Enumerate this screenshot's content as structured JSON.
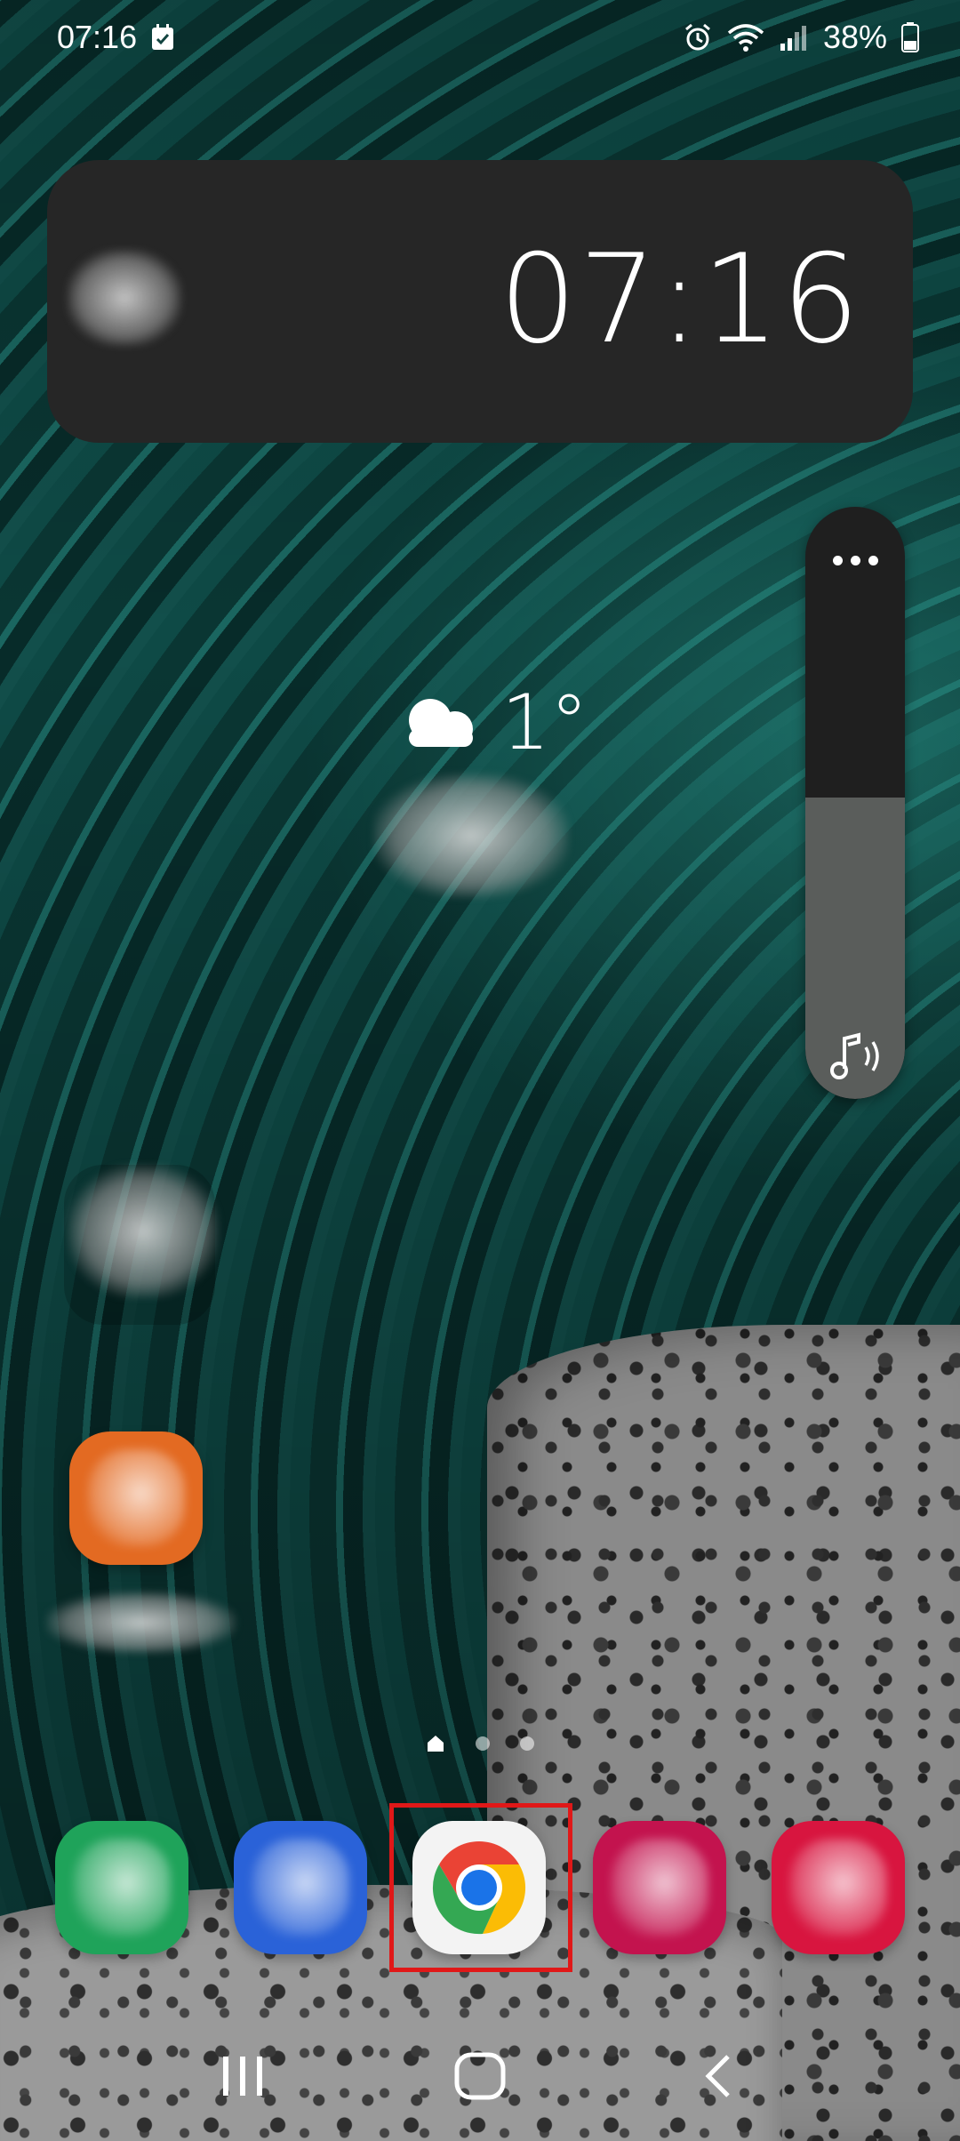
{
  "status_bar": {
    "time": "07:16",
    "battery_percent": "38%",
    "icons": [
      "calendar-check-icon",
      "alarm-icon",
      "wifi-icon",
      "signal-icon",
      "battery-icon"
    ]
  },
  "clock_widget": {
    "time": "07:16"
  },
  "weather_widget": {
    "temperature": "1°",
    "icon": "partly-cloudy-icon"
  },
  "volume_panel": {
    "level": 0.62,
    "icon": "media-volume-icon",
    "more_icon": "more-dots-icon"
  },
  "home_apps": [
    {
      "name": "folder",
      "color": "#5e6a68"
    },
    {
      "name": "app",
      "color": "#e36a22"
    }
  ],
  "page_indicator": {
    "pages": 3,
    "current": 0,
    "home_icon": "home-page-icon"
  },
  "dock": {
    "apps": [
      {
        "name": "green-app",
        "color": "#1fa35a"
      },
      {
        "name": "blue-app",
        "color": "#2a62d8"
      },
      {
        "name": "chrome",
        "color": "#f3f3f3"
      },
      {
        "name": "magenta-app",
        "color": "#c3134e"
      },
      {
        "name": "red-app",
        "color": "#d8153f"
      }
    ],
    "highlight_color": "#e01818"
  },
  "nav_bar": {
    "buttons": [
      "recent-apps-icon",
      "home-icon",
      "back-icon"
    ]
  }
}
